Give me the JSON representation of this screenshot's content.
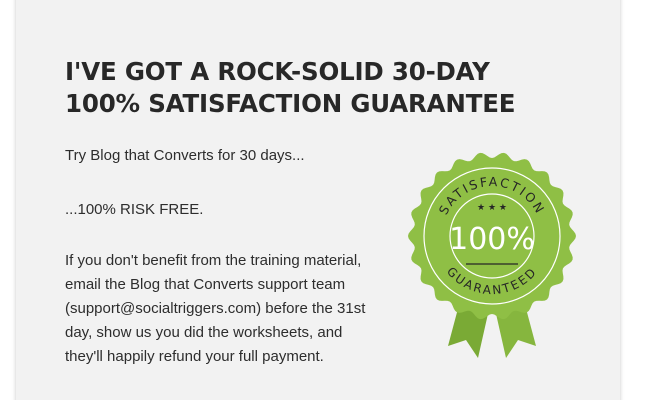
{
  "headline": {
    "line1": "I'VE GOT A ROCK-SOLID 30-DAY",
    "line2": "100% SATISFACTION GUARANTEE"
  },
  "paragraphs": {
    "try": "Try Blog that Converts for 30 days...",
    "risk_free": "...100% RISK FREE.",
    "refund_lines": [
      "If you don't benefit from the training material,",
      "email the Blog that Converts support team",
      "(support@socialtriggers.com) before the 31st",
      "day, show us you did the worksheets, and",
      "they'll happily refund your full payment."
    ]
  },
  "badge": {
    "top_text": "SATISFACTION",
    "stars": "★ ★ ★",
    "percent": "100%",
    "bottom_text": "GUARANTEED",
    "colors": {
      "seal": "#8fbf45",
      "seal_dark": "#7aaa35",
      "ink": "#ffffff",
      "ring_text": "#262626"
    }
  }
}
